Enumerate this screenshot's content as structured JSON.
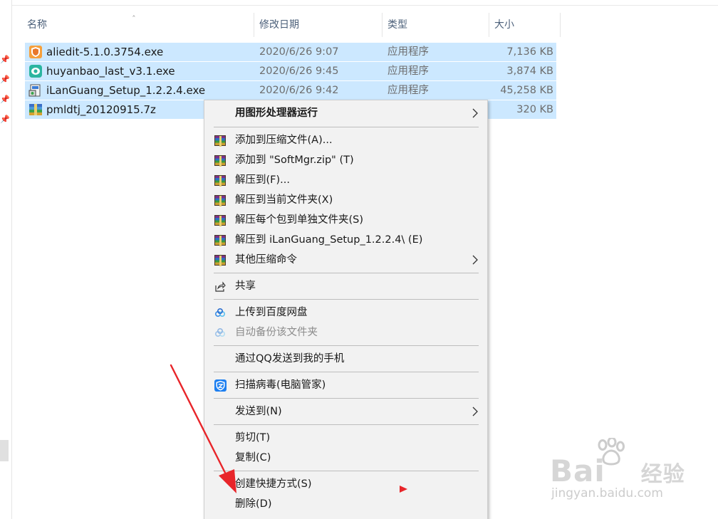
{
  "columns": {
    "name": "名称",
    "modified": "修改日期",
    "type": "类型",
    "size": "大小"
  },
  "files": [
    {
      "name": "aliedit-5.1.0.3754.exe",
      "date": "2020/6/26 9:07",
      "type": "应用程序",
      "size": "7,136 KB",
      "icon": "aliedit-shield-icon"
    },
    {
      "name": "huyanbao_last_v3.1.exe",
      "date": "2020/6/26 9:45",
      "type": "应用程序",
      "size": "3,874 KB",
      "icon": "huyanbao-eye-icon"
    },
    {
      "name": "iLanGuang_Setup_1.2.2.4.exe",
      "date": "2020/6/26 9:42",
      "type": "应用程序",
      "size": "45,258 KB",
      "icon": "setup-installer-icon"
    },
    {
      "name": "pmldtj_20120915.7z",
      "date": "",
      "type": "",
      "size": "320 KB",
      "icon": "archive-icon"
    }
  ],
  "context_menu": {
    "gpu": "用图形处理器运行",
    "add_archive": "添加到压缩文件(A)...",
    "add_zip": "添加到 \"SoftMgr.zip\" (T)",
    "extract_to": "解压到(F)...",
    "extract_here": "解压到当前文件夹(X)",
    "extract_each": "解压每个包到单独文件夹(S)",
    "extract_named": "解压到 iLanGuang_Setup_1.2.2.4\\ (E)",
    "other_compress": "其他压缩命令",
    "share": "共享",
    "upload_baidu": "上传到百度网盘",
    "auto_backup": "自动备份该文件夹",
    "qq_send": "通过QQ发送到我的手机",
    "scan_virus": "扫描病毒(电脑管家)",
    "send_to": "发送到(N)",
    "cut": "剪切(T)",
    "copy": "复制(C)",
    "shortcut": "创建快捷方式(S)",
    "delete": "删除(D)"
  },
  "watermark": {
    "main": "Bai",
    "main2": "经验",
    "sub": "jingyan.baidu.com"
  },
  "colors": {
    "selection": "#cce8ff",
    "menu_bg": "#f2f2f2",
    "annotation_red": "#e8252a"
  }
}
